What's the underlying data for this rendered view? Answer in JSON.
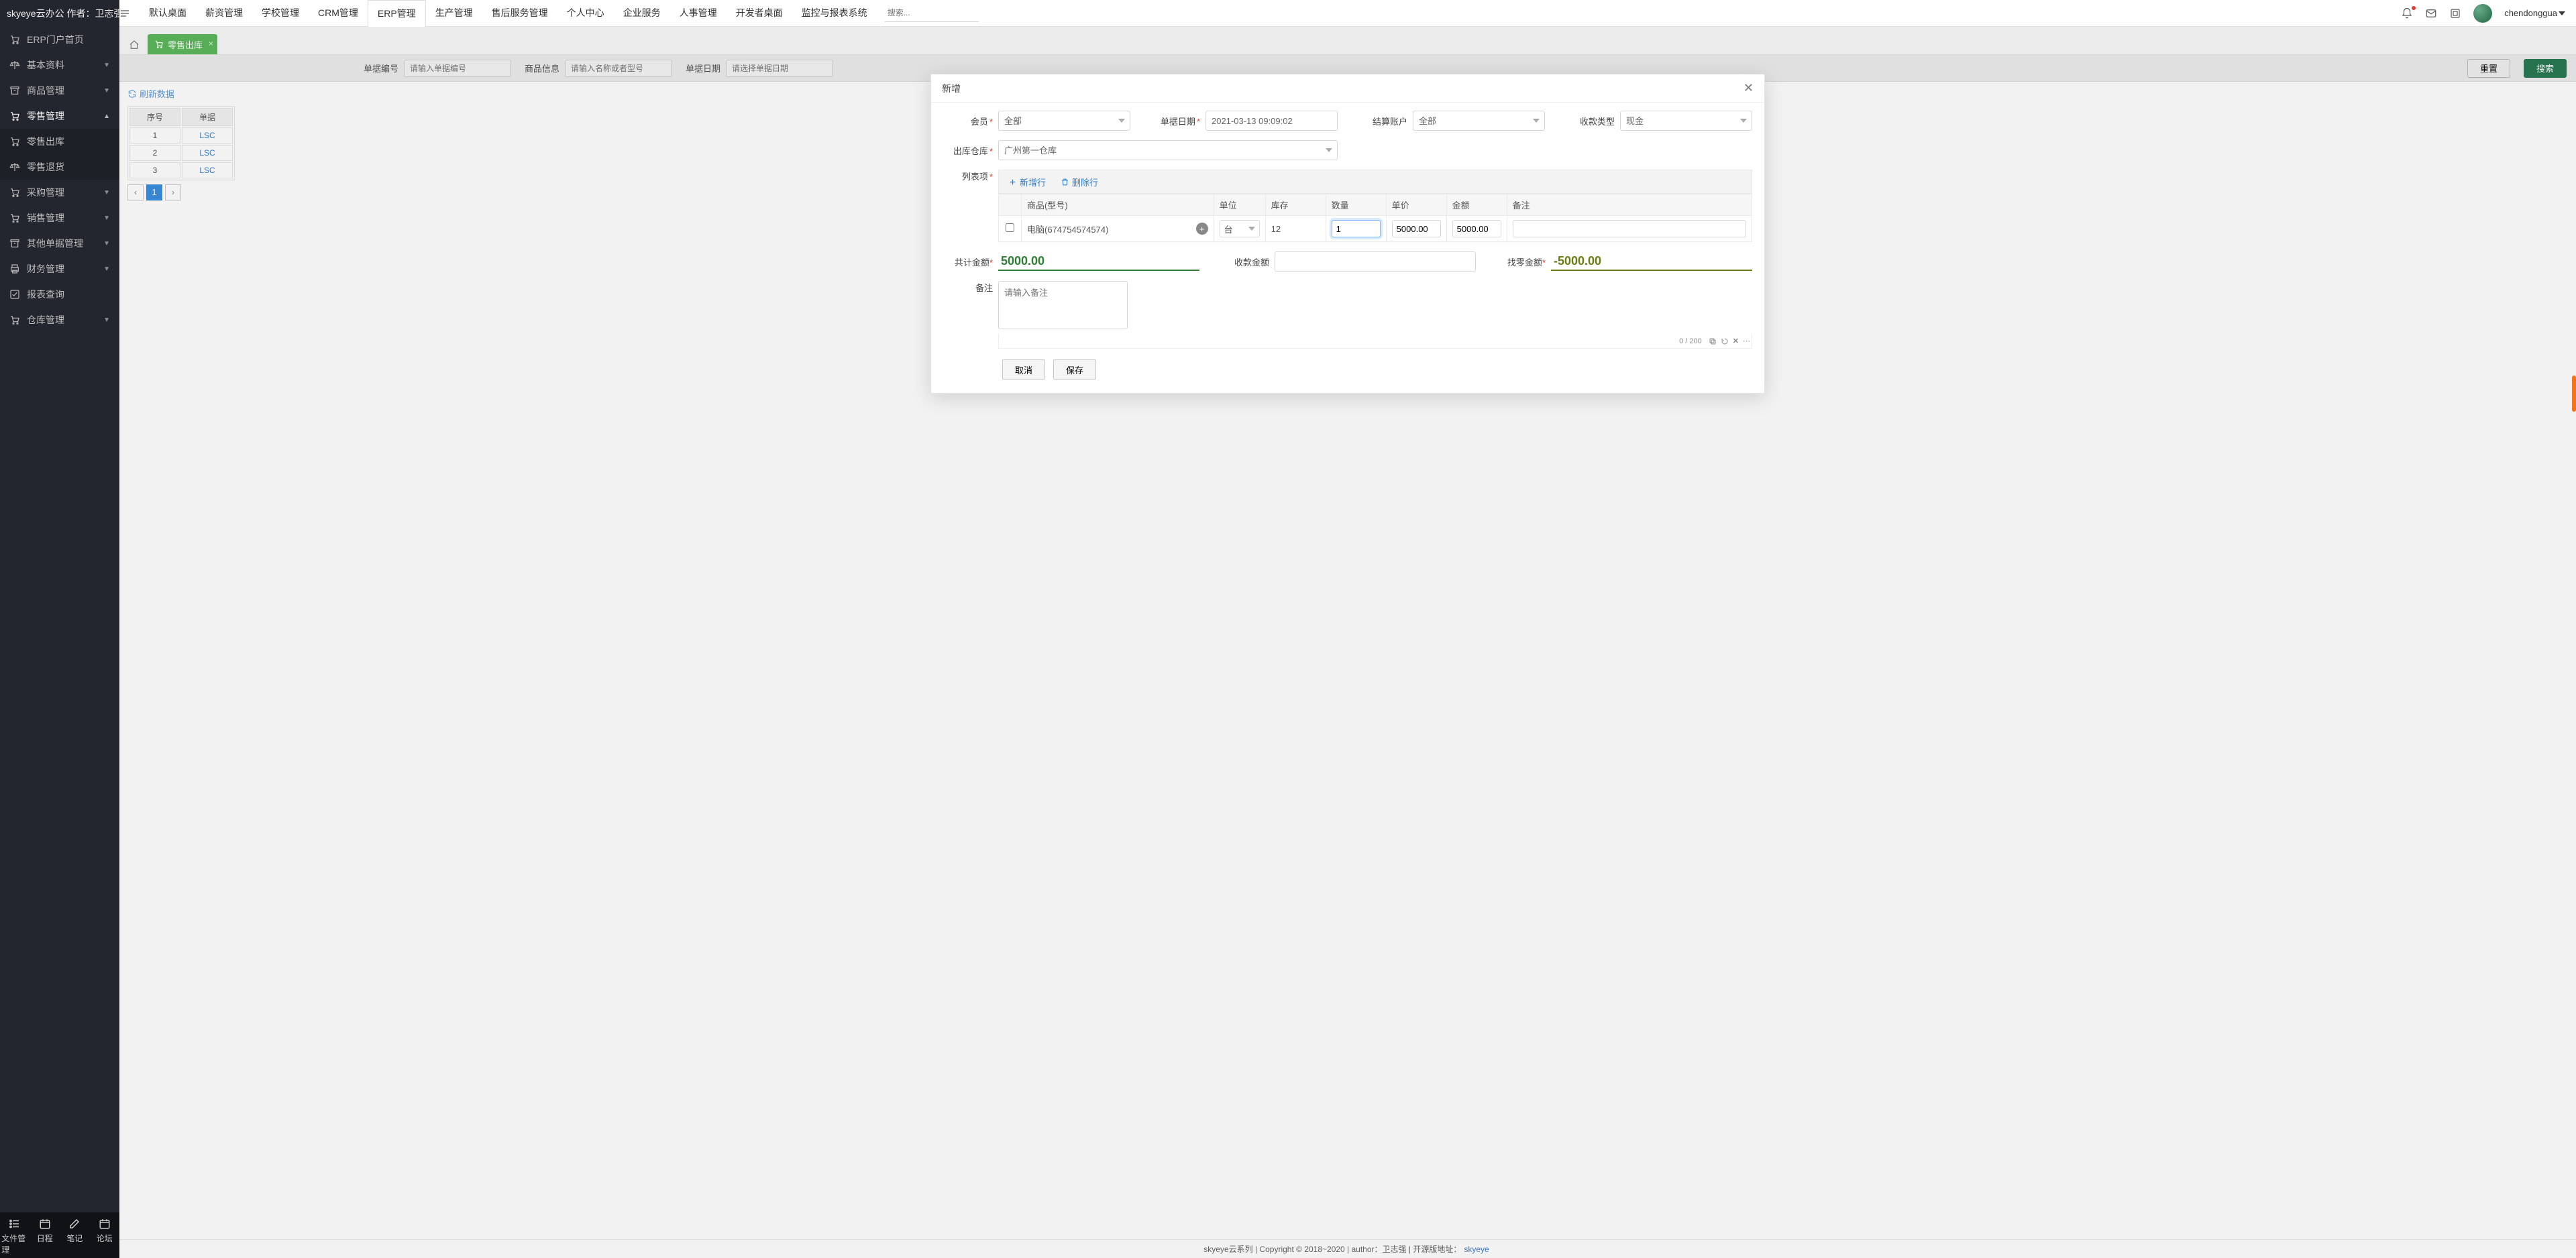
{
  "brand": {
    "name": "skyeye云办公",
    "author_prefix": "作者：",
    "author": "卫志强"
  },
  "topnav": {
    "items": [
      "默认桌面",
      "薪资管理",
      "学校管理",
      "CRM管理",
      "ERP管理",
      "生产管理",
      "售后服务管理",
      "个人中心",
      "企业服务",
      "人事管理",
      "开发者桌面",
      "监控与报表系统"
    ],
    "active_index": 4,
    "search_placeholder": "搜索..."
  },
  "user": {
    "name": "chendonggua"
  },
  "sidebar": {
    "items": [
      {
        "label": "ERP门户首页",
        "icon": "cart",
        "expandable": false
      },
      {
        "label": "基本资料",
        "icon": "scale",
        "expandable": true
      },
      {
        "label": "商品管理",
        "icon": "archive",
        "expandable": true
      },
      {
        "label": "零售管理",
        "icon": "cart",
        "expandable": true,
        "open": true,
        "children": [
          {
            "label": "零售出库",
            "icon": "cart"
          },
          {
            "label": "零售退货",
            "icon": "scale"
          }
        ]
      },
      {
        "label": "采购管理",
        "icon": "cart",
        "expandable": true
      },
      {
        "label": "销售管理",
        "icon": "cart",
        "expandable": true
      },
      {
        "label": "其他单据管理",
        "icon": "archive",
        "expandable": true
      },
      {
        "label": "财务管理",
        "icon": "print",
        "expandable": true
      },
      {
        "label": "报表查询",
        "icon": "check",
        "expandable": false
      },
      {
        "label": "仓库管理",
        "icon": "cart",
        "expandable": true
      }
    ],
    "footer": [
      {
        "label": "文件管理",
        "icon": "list"
      },
      {
        "label": "日程",
        "icon": "calendar"
      },
      {
        "label": "笔记",
        "icon": "edit"
      },
      {
        "label": "论坛",
        "icon": "calendar"
      }
    ]
  },
  "tabs": {
    "active": {
      "label": "零售出库"
    }
  },
  "searchbar": {
    "fields": {
      "order_no": {
        "label": "单据编号",
        "placeholder": "请输入单据编号"
      },
      "product": {
        "label": "商品信息",
        "placeholder": "请输入名称或者型号"
      },
      "date": {
        "label": "单据日期",
        "placeholder": "请选择单据日期"
      }
    },
    "reset": "重置",
    "search": "搜索"
  },
  "bg_grid": {
    "refresh": "刷新数据",
    "headers": [
      "序号",
      "单据"
    ],
    "rows": [
      [
        "1",
        "LSC"
      ],
      [
        "2",
        "LSC"
      ],
      [
        "3",
        "LSC"
      ]
    ],
    "pager_current": "1"
  },
  "modal": {
    "title": "新增",
    "fields": {
      "member": {
        "label": "会员",
        "value": "全部"
      },
      "date": {
        "label": "单据日期",
        "value": "2021-03-13 09:09:02"
      },
      "account": {
        "label": "结算账户",
        "value": "全部"
      },
      "pay_type": {
        "label": "收款类型",
        "value": "现金"
      },
      "warehouse": {
        "label": "出库仓库",
        "value": "广州第一仓库"
      },
      "list": {
        "label": "列表项"
      }
    },
    "list_toolbar": {
      "add": "新增行",
      "del": "删除行"
    },
    "grid": {
      "headers": [
        "",
        "商品(型号)",
        "单位",
        "库存",
        "数量",
        "单价",
        "金额",
        "备注"
      ],
      "row": {
        "product": "电脑(674754574574)",
        "unit": "台",
        "stock": "12",
        "qty": "1",
        "price": "5000.00",
        "amount": "5000.00",
        "remark": ""
      }
    },
    "totals": {
      "total": {
        "label": "共计金额",
        "value": "5000.00"
      },
      "paid": {
        "label": "收款金额",
        "value": ""
      },
      "change": {
        "label": "找零金额",
        "value": "-5000.00"
      }
    },
    "remark": {
      "label": "备注",
      "placeholder": "请输入备注",
      "counter_cur": "0",
      "counter_max": "200"
    },
    "actions": {
      "cancel": "取消",
      "save": "保存"
    }
  },
  "footer": {
    "series": "skyeye云系列",
    "copyright": "Copyright © 2018~2020",
    "author_label": "author：",
    "author": "卫志强",
    "open_label": "开源版地址：",
    "link": "skyeye"
  }
}
